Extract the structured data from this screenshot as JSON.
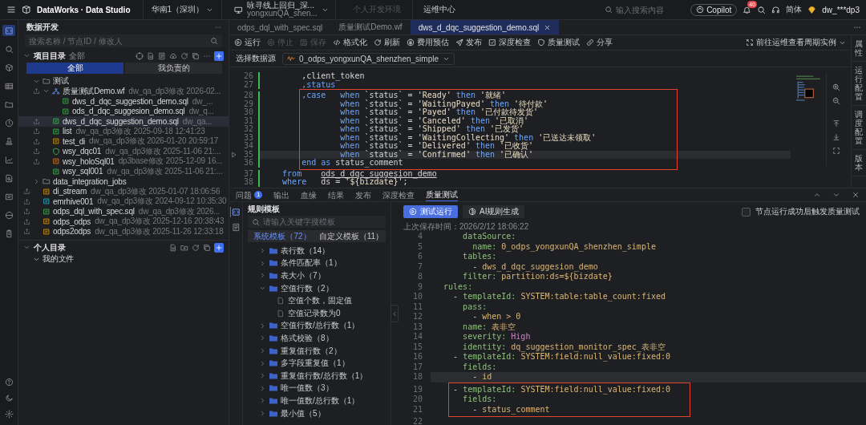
{
  "top_bar": {
    "product": "DataWorks · Data Studio",
    "region": "华南1（深圳）",
    "workspace": {
      "name": "咏寻线上回归_深...",
      "id": "yongxunQA_shen..."
    },
    "env": {
      "label": "个人开发环境",
      "disabled": true
    },
    "ops": "运维中心",
    "search": {
      "placeholder": "输入搜索内容"
    },
    "copilot": "Copilot",
    "notifications": "40",
    "language": "简体",
    "user": "dw_***dp3"
  },
  "nav_rail": [
    {
      "selected": true
    },
    {
      "selected": false
    },
    {
      "selected": false
    },
    {
      "selected": false
    },
    {
      "selected": false
    },
    {
      "selected": false
    },
    {
      "selected": false
    },
    {
      "selected": false
    },
    {
      "selected": false
    },
    {
      "selected": false
    },
    {
      "selected": false
    },
    {
      "selected": false
    }
  ],
  "sidebar": {
    "title": "数据开发",
    "search": {
      "placeholder": "搜索名称 / 节点ID / 修改人"
    },
    "project": {
      "title": "项目目录",
      "scope": "全部",
      "expanded": true
    },
    "filter_tabs": [
      {
        "label": "全部",
        "selected": true
      },
      {
        "label": "我负责的",
        "selected": false
      }
    ],
    "tree": [
      {
        "name": "测试",
        "kind": "folder",
        "expanded": true,
        "selected": false,
        "children": [
          {
            "name": "质量测试Demo.wf",
            "kind": "workflow",
            "meta": "dw_qa_dp3修改 2026-02...",
            "submitted": true,
            "expanded": true,
            "selected": false,
            "children": [
              {
                "name": "dws_d_dqc_suggestion_demo.sql",
                "kind": "sql",
                "meta": "dw_...",
                "submitted": false,
                "selected": false
              },
              {
                "name": "ods_d_dqc_suggesion_demo.sql",
                "kind": "sql",
                "meta": "dw_q...",
                "submitted": false,
                "selected": false
              }
            ]
          },
          {
            "name": "dws_d_dqc_suggestion_demo.sql",
            "kind": "sql",
            "meta": "dw_qa...",
            "submitted": true,
            "selected": true
          },
          {
            "name": "list",
            "kind": "list",
            "meta": "dw_qa_dp3修改 2025-09-18 12:41:23",
            "submitted": true,
            "selected": false
          },
          {
            "name": "test_di",
            "kind": "di",
            "meta": "dw_qa_dp3修改 2026-01-20 20:59:17",
            "submitted": true,
            "selected": false
          },
          {
            "name": "wsy_dqc01",
            "kind": "dqc",
            "meta": "dw_qa_dp3修改 2025-11-06 21:...",
            "submitted": true,
            "selected": false
          },
          {
            "name": "wsy_holoSql01",
            "kind": "holo",
            "meta": "dp3base修改 2025-12-09 16...",
            "submitted": true,
            "selected": false
          },
          {
            "name": "wsy_sql001",
            "kind": "sql",
            "meta": "dw_qa_dp3修改 2025-11-06 21:...",
            "submitted": false,
            "selected": false
          }
        ]
      },
      {
        "name": "data_integration_jobs",
        "kind": "folder",
        "expanded": false,
        "selected": false
      },
      {
        "name": "di_stream",
        "kind": "di",
        "meta": "dw_qa_dp3修改 2025-01-07 18:06:56",
        "submitted": true,
        "selected": false
      },
      {
        "name": "emrhive001",
        "kind": "emr",
        "meta": "dw_qa_dp3修改 2024-09-12 10:35:30",
        "submitted": true,
        "selected": false
      },
      {
        "name": "odps_dql_with_spec.sql",
        "kind": "sql",
        "meta": "dw_qa_dp3修改 2026...",
        "submitted": true,
        "selected": false
      },
      {
        "name": "odps_odps",
        "kind": "di",
        "meta": "dw_qa_dp3修改 2025-12-16 20:38:43",
        "submitted": true,
        "selected": false
      },
      {
        "name": "odps2odps",
        "kind": "di",
        "meta": "dw_qa_dp3修改 2025-11-26 12:33:18",
        "submitted": true,
        "selected": false
      }
    ],
    "personal": {
      "title": "个人目录",
      "expanded": true,
      "items": [
        {
          "name": "我的文件",
          "expanded": true
        }
      ]
    }
  },
  "editor_tabs": [
    {
      "label": "odps_dql_with_spec.sql",
      "selected": false
    },
    {
      "label": "质量测试Demo.wf",
      "selected": false
    },
    {
      "label": "dws_d_dqc_suggestion_demo.sql",
      "selected": true
    }
  ],
  "toolbar": [
    {
      "label": "运行",
      "disabled": false
    },
    {
      "label": "停止",
      "disabled": true
    },
    {
      "label": "保存",
      "disabled": true
    },
    {
      "label": "格式化",
      "disabled": false
    },
    {
      "label": "刷新",
      "disabled": false
    },
    {
      "label": "费用预估",
      "disabled": false
    },
    {
      "label": "发布",
      "disabled": false
    },
    {
      "label": "深度检查",
      "disabled": false
    },
    {
      "label": "质量测试",
      "disabled": false
    },
    {
      "label": "分享",
      "disabled": false
    }
  ],
  "ops_link": "前往运维查看周期实例",
  "datasource": {
    "label": "选择数据源",
    "value": "0_odps_yongxunQA_shenzhen_simple"
  },
  "code": {
    "lines": [
      {
        "n": "26",
        "selected": false,
        "marked": false,
        "tokens": [
          {
            "kind": "plain",
            "text": "        ,client_token"
          }
        ]
      },
      {
        "n": "27",
        "selected": false,
        "marked": false,
        "tokens": [
          {
            "kind": "keyword",
            "text": "        ,status"
          }
        ]
      },
      {
        "n": "28",
        "selected": false,
        "marked": true,
        "tokens": [
          {
            "kind": "keyword",
            "text": "        ,case   when "
          },
          {
            "kind": "plain",
            "text": "`status` = "
          },
          {
            "kind": "string",
            "text": "'Ready'"
          },
          {
            "kind": "keyword",
            "text": " then "
          },
          {
            "kind": "string",
            "text": "'就绪'"
          }
        ]
      },
      {
        "n": "29",
        "selected": false,
        "marked": true,
        "tokens": [
          {
            "kind": "keyword",
            "text": "                when "
          },
          {
            "kind": "plain",
            "text": "`status` = "
          },
          {
            "kind": "string",
            "text": "'WaitingPayed'"
          },
          {
            "kind": "keyword",
            "text": " then "
          },
          {
            "kind": "string",
            "text": "'待付款'"
          }
        ]
      },
      {
        "n": "30",
        "selected": false,
        "marked": true,
        "tokens": [
          {
            "kind": "keyword",
            "text": "                when "
          },
          {
            "kind": "plain",
            "text": "`status` = "
          },
          {
            "kind": "string",
            "text": "'Payed'"
          },
          {
            "kind": "keyword",
            "text": " then "
          },
          {
            "kind": "string",
            "text": "'已付款待发货'"
          }
        ]
      },
      {
        "n": "31",
        "selected": false,
        "marked": true,
        "tokens": [
          {
            "kind": "keyword",
            "text": "                when "
          },
          {
            "kind": "plain",
            "text": "`status` = "
          },
          {
            "kind": "string",
            "text": "'Canceled'"
          },
          {
            "kind": "keyword",
            "text": " then "
          },
          {
            "kind": "string",
            "text": "'已取消'"
          }
        ]
      },
      {
        "n": "32",
        "selected": false,
        "marked": true,
        "tokens": [
          {
            "kind": "keyword",
            "text": "                when "
          },
          {
            "kind": "plain",
            "text": "`status` = "
          },
          {
            "kind": "string",
            "text": "'Shipped'"
          },
          {
            "kind": "keyword",
            "text": " then "
          },
          {
            "kind": "string",
            "text": "'已发货'"
          }
        ]
      },
      {
        "n": "33",
        "selected": false,
        "marked": true,
        "tokens": [
          {
            "kind": "keyword",
            "text": "                when "
          },
          {
            "kind": "plain",
            "text": "`status` = "
          },
          {
            "kind": "string",
            "text": "'WaitingCollecting'"
          },
          {
            "kind": "keyword",
            "text": " then "
          },
          {
            "kind": "string",
            "text": "'已送达未领取'"
          }
        ]
      },
      {
        "n": "34",
        "selected": false,
        "marked": true,
        "tokens": [
          {
            "kind": "keyword",
            "text": "                when "
          },
          {
            "kind": "plain",
            "text": "`status` = "
          },
          {
            "kind": "string",
            "text": "'Delivered'"
          },
          {
            "kind": "keyword",
            "text": " then "
          },
          {
            "kind": "string",
            "text": "'已收货'"
          }
        ]
      },
      {
        "n": "35",
        "selected": true,
        "marked": true,
        "tokens": [
          {
            "kind": "keyword",
            "text": "                when "
          },
          {
            "kind": "plain",
            "text": "`status` = "
          },
          {
            "kind": "string",
            "text": "'Confirmed'"
          },
          {
            "kind": "keyword",
            "text": " then "
          },
          {
            "kind": "string",
            "text": "'已确认'"
          }
        ]
      },
      {
        "n": "36",
        "selected": false,
        "marked": true,
        "tokens": [
          {
            "kind": "keyword",
            "text": "        end as "
          },
          {
            "kind": "plain",
            "text": "status_comment"
          }
        ]
      },
      {
        "n": "37",
        "selected": false,
        "marked": false,
        "tokens": [
          {
            "kind": "keyword",
            "text": "    from    "
          },
          {
            "kind": "reference",
            "text": "ods_d_dqc_suggesion_demo"
          }
        ]
      },
      {
        "n": "38",
        "selected": false,
        "marked": false,
        "tokens": [
          {
            "kind": "keyword",
            "text": "    where   "
          },
          {
            "kind": "plain",
            "text": "ds = "
          },
          {
            "kind": "string",
            "text": "'${bizdate}'"
          },
          {
            "kind": "plain",
            "text": ";"
          }
        ]
      }
    ]
  },
  "side_tabs": [
    {
      "label": "属性",
      "selected": false
    },
    {
      "label": "运行配置",
      "selected": false
    },
    {
      "label": "调度配置",
      "selected": false
    },
    {
      "label": "版本",
      "selected": false
    }
  ],
  "bottom_panel": {
    "tabs": [
      {
        "label": "问题",
        "badge": "1",
        "selected": false
      },
      {
        "label": "输出",
        "selected": false
      },
      {
        "label": "血缘",
        "selected": false
      },
      {
        "label": "结果",
        "selected": false
      },
      {
        "label": "发布",
        "selected": false
      },
      {
        "label": "深度检查",
        "selected": false
      },
      {
        "label": "质量测试",
        "selected": true
      }
    ],
    "views": [
      {
        "selected": true
      },
      {
        "selected": false
      }
    ],
    "rules": {
      "title": "规则模板",
      "search": {
        "placeholder": "请输入关键字搜模板"
      },
      "tabs": [
        {
          "label": "系统模板（72）",
          "selected": true
        },
        {
          "label": "自定义模板（11）",
          "selected": false
        }
      ],
      "tree": [
        {
          "name": "表行数（14）",
          "expanded": false
        },
        {
          "name": "条件匹配率（1）",
          "expanded": false
        },
        {
          "name": "表大小（7）",
          "expanded": false
        },
        {
          "name": "空值行数（2）",
          "expanded": true,
          "children": [
            {
              "name": "空值个数，固定值"
            },
            {
              "name": "空值记录数为0"
            }
          ]
        },
        {
          "name": "空值行数/总行数（1）",
          "expanded": false
        },
        {
          "name": "格式校验（8）",
          "expanded": false
        },
        {
          "name": "重复值行数（2）",
          "expanded": false
        },
        {
          "name": "多字段重复值（1）",
          "expanded": false
        },
        {
          "name": "重复值行数/总行数（1）",
          "expanded": false
        },
        {
          "name": "唯一值数（3）",
          "expanded": false
        },
        {
          "name": "唯一值数/总行数（1）",
          "expanded": false
        },
        {
          "name": "最小值（5）",
          "expanded": false
        }
      ]
    },
    "actions": [
      {
        "label": "测试运行",
        "kind": "primary"
      },
      {
        "label": "AI规则生成",
        "kind": "secondary"
      }
    ],
    "trigger": {
      "label": "节点运行成功后触发质量测试",
      "checked": false
    },
    "saved_time": "上次保存时间：2026/2/12 18:06:22",
    "yaml": {
      "lines": [
        {
          "n": "4",
          "selected": false,
          "marked": false,
          "tokens": [
            {
              "kind": "key",
              "text": "      dataSource:"
            }
          ]
        },
        {
          "n": "5",
          "selected": false,
          "marked": false,
          "tokens": [
            {
              "kind": "key",
              "text": "        name: "
            },
            {
              "kind": "value",
              "text": "0_odps_yongxunQA_shenzhen_simple"
            }
          ]
        },
        {
          "n": "6",
          "selected": false,
          "marked": false,
          "tokens": [
            {
              "kind": "key",
              "text": "      tables:"
            }
          ]
        },
        {
          "n": "7",
          "selected": false,
          "marked": false,
          "tokens": [
            {
              "kind": "dash",
              "text": "        - "
            },
            {
              "kind": "value",
              "text": "dws_d_dqc_suggesion_demo"
            }
          ]
        },
        {
          "n": "8",
          "selected": false,
          "marked": false,
          "tokens": [
            {
              "kind": "key",
              "text": "      filter: "
            },
            {
              "kind": "value",
              "text": "partition:ds=${bizdate}"
            }
          ]
        },
        {
          "n": "9",
          "selected": false,
          "marked": false,
          "tokens": [
            {
              "kind": "key",
              "text": "  rules:"
            }
          ]
        },
        {
          "n": "10",
          "selected": false,
          "marked": false,
          "tokens": [
            {
              "kind": "dash",
              "text": "    - "
            },
            {
              "kind": "key",
              "text": "templateId: "
            },
            {
              "kind": "value",
              "text": "SYSTEM:table:table_count:fixed"
            }
          ]
        },
        {
          "n": "11",
          "selected": false,
          "marked": false,
          "tokens": [
            {
              "kind": "key",
              "text": "      pass:"
            }
          ]
        },
        {
          "n": "12",
          "selected": false,
          "marked": false,
          "tokens": [
            {
              "kind": "dash",
              "text": "        - "
            },
            {
              "kind": "value",
              "text": "when > 0"
            }
          ]
        },
        {
          "n": "13",
          "selected": false,
          "marked": false,
          "tokens": [
            {
              "kind": "key",
              "text": "      name: "
            },
            {
              "kind": "value",
              "text": "表非空"
            }
          ]
        },
        {
          "n": "14",
          "selected": false,
          "marked": false,
          "tokens": [
            {
              "kind": "key",
              "text": "      severity: "
            },
            {
              "kind": "enum",
              "text": "High"
            }
          ]
        },
        {
          "n": "15",
          "selected": false,
          "marked": false,
          "tokens": [
            {
              "kind": "key",
              "text": "      identity: "
            },
            {
              "kind": "value",
              "text": "dq_suggestion_monitor_spec_表非空"
            }
          ]
        },
        {
          "n": "16",
          "selected": false,
          "marked": false,
          "tokens": [
            {
              "kind": "dash",
              "text": "    - "
            },
            {
              "kind": "key",
              "text": "templateId: "
            },
            {
              "kind": "value",
              "text": "SYSTEM:field:null_value:fixed:0"
            }
          ]
        },
        {
          "n": "17",
          "selected": false,
          "marked": false,
          "tokens": [
            {
              "kind": "key",
              "text": "      fields:"
            }
          ]
        },
        {
          "n": "18",
          "selected": true,
          "marked": false,
          "tokens": [
            {
              "kind": "dash",
              "text": "        - "
            },
            {
              "kind": "value",
              "text": "id"
            }
          ]
        },
        {
          "n": "19",
          "selected": false,
          "marked": true,
          "tokens": [
            {
              "kind": "dash",
              "text": "    - "
            },
            {
              "kind": "key",
              "text": "templateId: "
            },
            {
              "kind": "value",
              "text": "SYSTEM:field:null_value:fixed:0"
            }
          ]
        },
        {
          "n": "20",
          "selected": false,
          "marked": true,
          "tokens": [
            {
              "kind": "key",
              "text": "      fields:"
            }
          ]
        },
        {
          "n": "21",
          "selected": false,
          "marked": true,
          "tokens": [
            {
              "kind": "dash",
              "text": "        - "
            },
            {
              "kind": "value",
              "text": "status_comment"
            }
          ]
        },
        {
          "n": "22",
          "selected": false,
          "marked": false
        }
      ]
    }
  }
}
